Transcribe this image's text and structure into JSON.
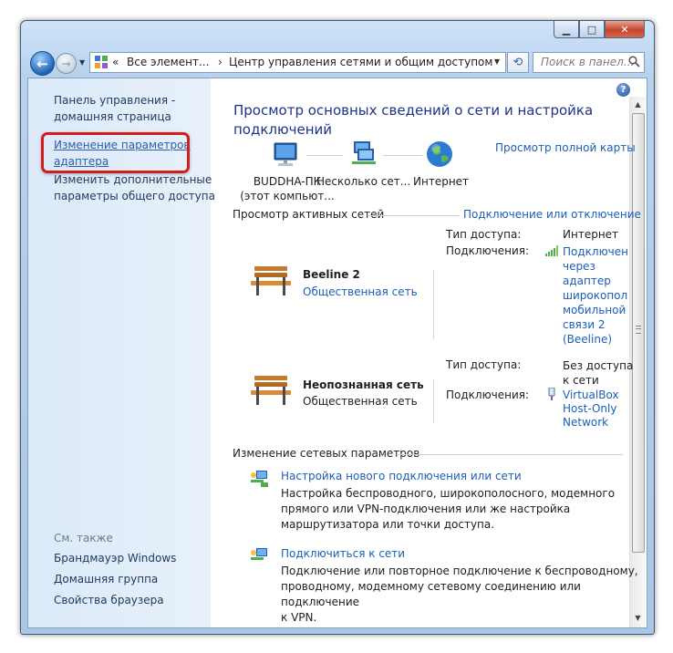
{
  "window": {
    "buttons": {
      "minimize": "▁",
      "maximize": "□",
      "close": "✕"
    }
  },
  "nav": {
    "back": "←",
    "forward": "→",
    "address_parts": [
      "«",
      "Все элемент...",
      "›",
      "Центр управления сетями и общим доступом"
    ],
    "search_placeholder": "Поиск в панел...",
    "refresh": "⟲"
  },
  "left_pane": {
    "home": [
      "Панель управления -",
      "домашняя страница"
    ],
    "change_adapter": [
      "Изменение параметров",
      "адаптера"
    ],
    "change_sharing": [
      "Изменить дополнительные",
      "параметры общего доступа"
    ],
    "see_also": "См. также",
    "links": [
      "Брандмауэр Windows",
      "Домашняя группа",
      "Свойства браузера"
    ]
  },
  "main": {
    "title": [
      "Просмотр основных сведений о сети и настройка",
      "подключений"
    ],
    "full_map": "Просмотр полной карты",
    "map": {
      "computer": [
        "BUDDHA-ПК",
        "(этот компьют..."
      ],
      "networks": "Несколько сет...",
      "internet": "Интернет"
    },
    "active_header": "Просмотр активных сетей",
    "connect_link": "Подключение или отключение",
    "networks": [
      {
        "name": "Beeline  2",
        "type": "Общественная сеть",
        "access_label": "Тип доступа:",
        "access_value": [
          "Интернет"
        ],
        "conn_label": "Подключения:",
        "conn_value": [
          "Подключен",
          "через",
          "адаптер",
          "широкопол",
          "мобильной",
          "связи 2",
          "(Beeline)"
        ]
      },
      {
        "name": "Неопознанная сеть",
        "type": "Общественная сеть",
        "access_label": "Тип доступа:",
        "access_value": [
          "Без доступа",
          "к сети"
        ],
        "conn_label": "Подключения:",
        "conn_value": [
          "VirtualBox",
          "Host-Only",
          "Network"
        ]
      }
    ],
    "change_header": "Изменение сетевых параметров",
    "tasks": [
      {
        "link": "Настройка нового подключения или сети",
        "desc": [
          "Настройка беспроводного, широкополосного, модемного",
          "прямого или VPN-подключения или же настройка",
          "маршрутизатора или точки доступа."
        ]
      },
      {
        "link": "Подключиться к сети",
        "desc": [
          "Подключение или повторное подключение к беспроводному,",
          "проводному, модемному сетевому соединению или подключение",
          "к VPN."
        ]
      }
    ]
  },
  "icons": {
    "help": "?",
    "search": "🔍"
  },
  "colors": {
    "link": "#1a5fb4",
    "title": "#1e3287",
    "highlight_box": "#d21d1d"
  }
}
